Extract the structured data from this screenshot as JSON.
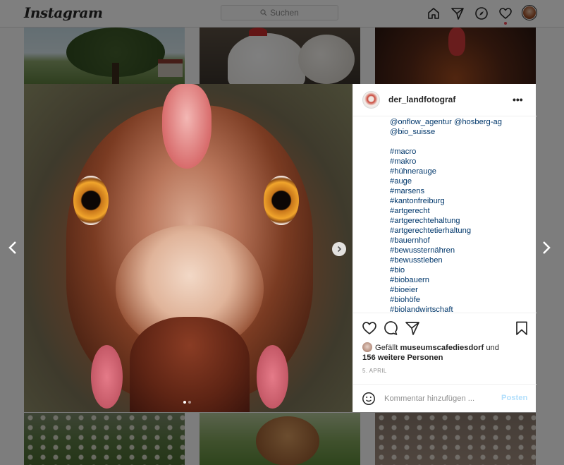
{
  "header": {
    "logo": "Instagram",
    "search_placeholder": "Suchen",
    "nav_icons": [
      "home-icon",
      "direct-message-icon",
      "explore-icon",
      "heart-icon",
      "profile-avatar"
    ]
  },
  "post": {
    "username": "der_landfotograf",
    "more_label": "•••",
    "caption_lines": [
      "@onflow_agentur @hosberg-ag",
      "@bio_suisse",
      "",
      "#macro",
      "#makro",
      "#hühnerauge",
      "#auge",
      "#marsens",
      "#kantonfreiburg",
      "#artgerecht",
      "#artgerechtehaltung",
      "#artgerechtetierhaltung",
      "#bauernhof",
      "#bewussternähren",
      "#bewusstleben",
      "#bio",
      "#biobauern",
      "#bioeier",
      "#biohöfe",
      "#biolandwirtschaft"
    ],
    "likes": {
      "prefix": "Gefällt",
      "user": "museumscafediesdorf",
      "connector": "und",
      "others": "156 weitere Personen"
    },
    "date": "5. APRIL",
    "comment_placeholder": "Kommentar hinzufügen ...",
    "post_label": "Posten",
    "carousel": {
      "count": 2,
      "active": 1
    }
  },
  "colors": {
    "link": "#00376b",
    "text": "#262626",
    "muted": "#8e8e8e",
    "post_button_disabled": "#b2dffc",
    "notification": "#ed4956"
  }
}
